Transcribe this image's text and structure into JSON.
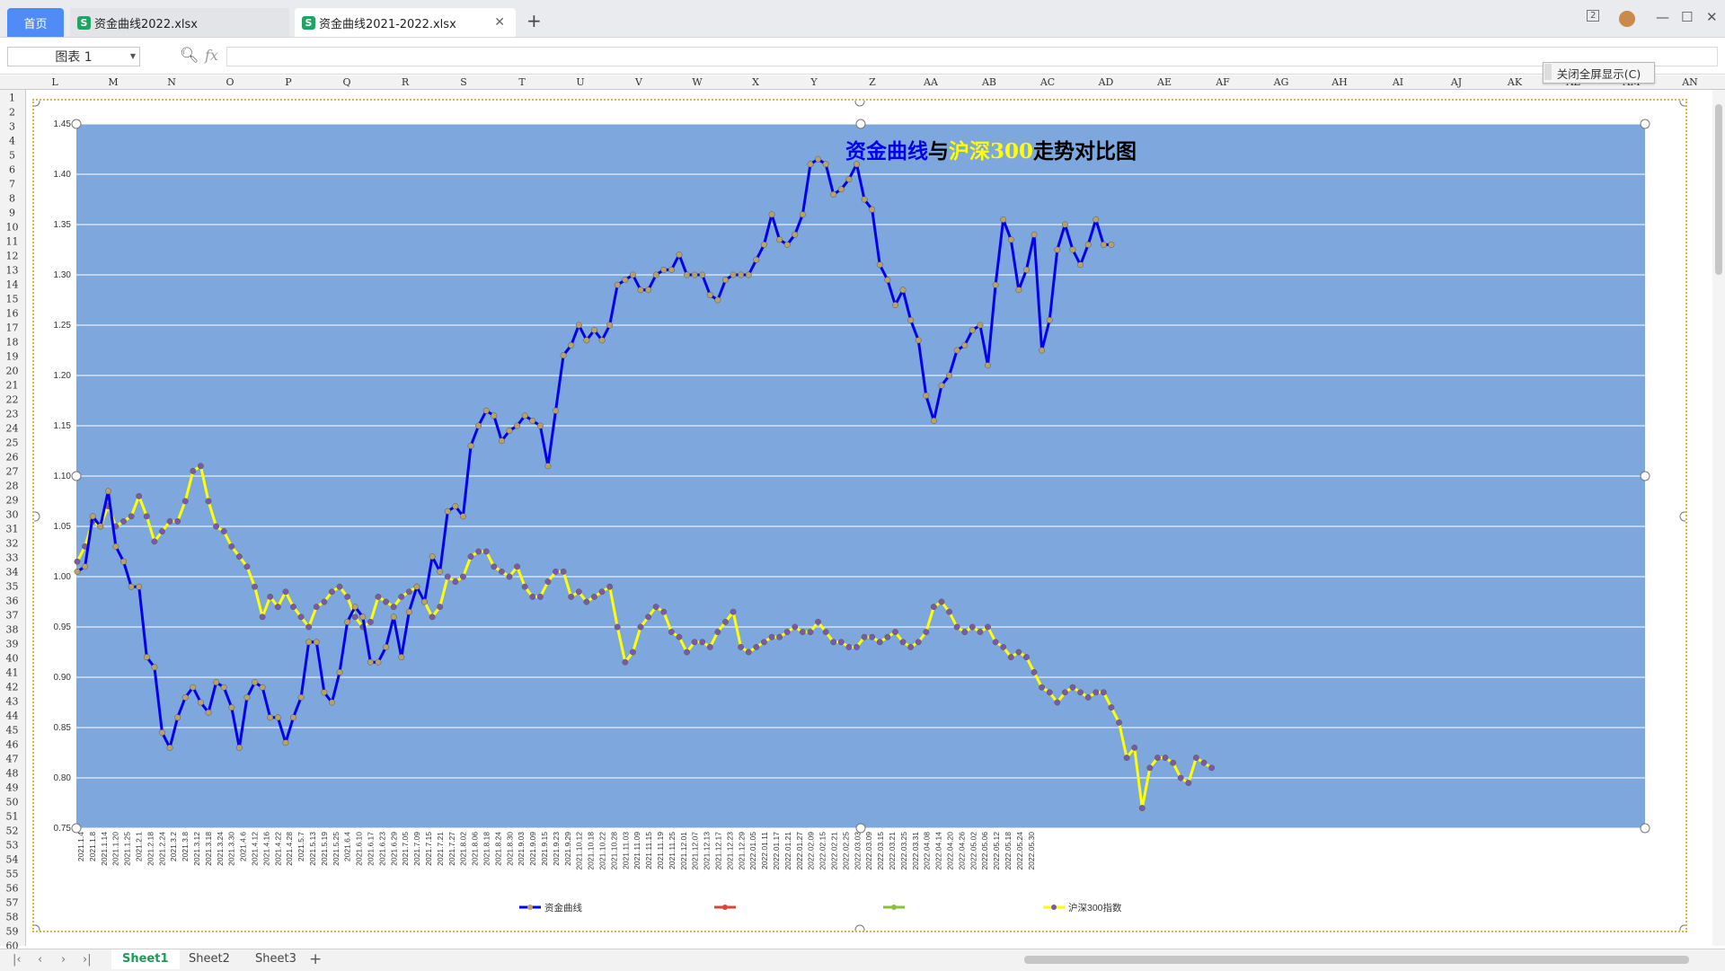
{
  "tabs": {
    "home": "首页",
    "file1": "资金曲线2022.xlsx",
    "file2": "资金曲线2021-2022.xlsx",
    "file_icon_letter": "S"
  },
  "window": {
    "layout_badge": "2",
    "avatar_text": "头像"
  },
  "toolbar": {
    "name_box": "图表 1",
    "fx": "fx",
    "formula_value": ""
  },
  "exit_fullscreen": "关闭全屏显示(C)",
  "columns": [
    "L",
    "M",
    "N",
    "O",
    "P",
    "Q",
    "R",
    "S",
    "T",
    "U",
    "V",
    "W",
    "X",
    "Y",
    "Z",
    "AA",
    "AB",
    "AC",
    "AD",
    "AE",
    "AF",
    "AG",
    "AH",
    "AI",
    "AJ",
    "AK",
    "AL",
    "AM",
    "AN"
  ],
  "rows": [
    1,
    2,
    3,
    4,
    5,
    6,
    7,
    8,
    9,
    10,
    11,
    12,
    13,
    14,
    15,
    16,
    17,
    18,
    19,
    20,
    21,
    22,
    23,
    24,
    25,
    26,
    27,
    28,
    29,
    30,
    31,
    32,
    33,
    34,
    35,
    36,
    37,
    38,
    39,
    40,
    41,
    42,
    43,
    44,
    45,
    46,
    47,
    48,
    49,
    50,
    51,
    52,
    53,
    54,
    55,
    56,
    57,
    58,
    59,
    60
  ],
  "sheets": [
    "Sheet1",
    "Sheet2",
    "Sheet3"
  ],
  "colors": {
    "plot_bg": "#7da7dd",
    "capital_line": "#0000ee",
    "hs300_line": "#ffff00",
    "capital_marker": "#b8a26a",
    "hs300_marker": "#7a5aa6",
    "series2": "#d9443b",
    "series3": "#8bbf3e",
    "selection": "#d8b443"
  },
  "chart_data": {
    "type": "line",
    "title_parts": [
      {
        "text": "资金曲线",
        "color": "#0000ee"
      },
      {
        "text": "与",
        "color": "#000000"
      },
      {
        "text": "沪深300",
        "color": "#ffff00"
      },
      {
        "text": "走势对比图",
        "color": "#000000"
      }
    ],
    "ylim": [
      0.75,
      1.45
    ],
    "yticks": [
      "1.45",
      "1.40",
      "1.35",
      "1.30",
      "1.25",
      "1.20",
      "1.15",
      "1.10",
      "1.05",
      "1.00",
      "0.95",
      "0.90",
      "0.85",
      "0.80",
      "0.75"
    ],
    "x_date_labels": [
      "2021.1.4",
      "2021.1.8",
      "2021.1.14",
      "2021.1.20",
      "2021.1.25",
      "2021.2.1",
      "2021.2.18",
      "2021.2.24",
      "2021.3.2",
      "2021.3.8",
      "2021.3.12",
      "2021.3.18",
      "2021.3.24",
      "2021.3.30",
      "2021.4.6",
      "2021.4.12",
      "2021.4.16",
      "2021.4.22",
      "2021.4.28",
      "2021.5.7",
      "2021.5.13",
      "2021.5.19",
      "2021.5.25",
      "2021.6.4",
      "2021.6.10",
      "2021.6.17",
      "2021.6.23",
      "2021.6.29",
      "2021.7.05",
      "2021.7.09",
      "2021.7.15",
      "2021.7.21",
      "2021.7.27",
      "2021.8.02",
      "2021.8.06",
      "2021.8.18",
      "2021.8.24",
      "2021.8.30",
      "2021.9.03",
      "2021.9.09",
      "2021.9.15",
      "2021.9.23",
      "2021.9.29",
      "2021.10.12",
      "2021.10.18",
      "2021.10.22",
      "2021.10.28",
      "2021.11.03",
      "2021.11.09",
      "2021.11.15",
      "2021.11.19",
      "2021.11.25",
      "2021.12.01",
      "2021.12.07",
      "2021.12.13",
      "2021.12.17",
      "2021.12.23",
      "2021.12.29",
      "2022.01.05",
      "2022.01.11",
      "2022.01.17",
      "2022.01.21",
      "2022.01.27",
      "2022.02.09",
      "2022.02.15",
      "2022.02.21",
      "2022.02.25",
      "2022.03.03",
      "2022.03.09",
      "2022.03.15",
      "2022.03.21",
      "2022.03.25",
      "2022.03.31",
      "2022.04.08",
      "2022.04.14",
      "2022.04.20",
      "2022.04.26",
      "2022.05.02",
      "2022.05.06",
      "2022.05.12",
      "2022.05.18",
      "2022.05.24",
      "2022.05.30"
    ],
    "series": [
      {
        "name": "资金曲线",
        "color": "#0000ee",
        "values": [
          1.005,
          1.01,
          1.06,
          1.05,
          1.085,
          1.03,
          1.015,
          0.99,
          0.99,
          0.92,
          0.91,
          0.845,
          0.83,
          0.86,
          0.88,
          0.89,
          0.875,
          0.865,
          0.895,
          0.89,
          0.87,
          0.83,
          0.88,
          0.895,
          0.89,
          0.86,
          0.86,
          0.835,
          0.86,
          0.88,
          0.935,
          0.935,
          0.885,
          0.875,
          0.905,
          0.955,
          0.97,
          0.96,
          0.915,
          0.915,
          0.93,
          0.96,
          0.92,
          0.965,
          0.99,
          0.975,
          1.02,
          1.005,
          1.065,
          1.07,
          1.06,
          1.13,
          1.15,
          1.165,
          1.16,
          1.135,
          1.145,
          1.15,
          1.16,
          1.155,
          1.15,
          1.11,
          1.165,
          1.22,
          1.23,
          1.25,
          1.235,
          1.245,
          1.235,
          1.25,
          1.29,
          1.295,
          1.3,
          1.285,
          1.285,
          1.3,
          1.305,
          1.305,
          1.32,
          1.3,
          1.3,
          1.3,
          1.28,
          1.275,
          1.295,
          1.3,
          1.3,
          1.3,
          1.315,
          1.33,
          1.36,
          1.335,
          1.33,
          1.34,
          1.36,
          1.41,
          1.415,
          1.41,
          1.38,
          1.385,
          1.395,
          1.41,
          1.375,
          1.365,
          1.31,
          1.295,
          1.27,
          1.285,
          1.255,
          1.235,
          1.18,
          1.155,
          1.19,
          1.2,
          1.225,
          1.23,
          1.245,
          1.25,
          1.21,
          1.29,
          1.355,
          1.335,
          1.285,
          1.305,
          1.34,
          1.225,
          1.255,
          1.325,
          1.35,
          1.325,
          1.31,
          1.33,
          1.355,
          1.33,
          1.33
        ]
      },
      {
        "name": "",
        "color": "#d9443b",
        "values": []
      },
      {
        "name": "",
        "color": "#8bbf3e",
        "values": []
      },
      {
        "name": "沪深300指数",
        "color": "#ffff00",
        "values": [
          1.015,
          1.03,
          1.055,
          1.05,
          1.07,
          1.05,
          1.055,
          1.06,
          1.08,
          1.06,
          1.035,
          1.045,
          1.055,
          1.055,
          1.075,
          1.105,
          1.11,
          1.075,
          1.05,
          1.045,
          1.03,
          1.02,
          1.01,
          0.99,
          0.96,
          0.98,
          0.97,
          0.985,
          0.97,
          0.96,
          0.95,
          0.97,
          0.975,
          0.985,
          0.99,
          0.98,
          0.96,
          0.95,
          0.955,
          0.98,
          0.975,
          0.97,
          0.98,
          0.985,
          0.99,
          0.975,
          0.96,
          0.97,
          1.0,
          0.995,
          1.0,
          1.02,
          1.025,
          1.025,
          1.01,
          1.005,
          1.0,
          1.01,
          0.99,
          0.98,
          0.98,
          0.995,
          1.005,
          1.005,
          0.98,
          0.985,
          0.975,
          0.98,
          0.985,
          0.99,
          0.95,
          0.915,
          0.925,
          0.95,
          0.96,
          0.97,
          0.965,
          0.945,
          0.94,
          0.925,
          0.935,
          0.935,
          0.93,
          0.945,
          0.955,
          0.965,
          0.93,
          0.925,
          0.93,
          0.935,
          0.94,
          0.94,
          0.945,
          0.95,
          0.945,
          0.945,
          0.955,
          0.945,
          0.935,
          0.935,
          0.93,
          0.93,
          0.94,
          0.94,
          0.935,
          0.94,
          0.945,
          0.935,
          0.93,
          0.935,
          0.945,
          0.97,
          0.975,
          0.965,
          0.95,
          0.945,
          0.95,
          0.945,
          0.95,
          0.935,
          0.93,
          0.92,
          0.925,
          0.92,
          0.905,
          0.89,
          0.885,
          0.875,
          0.885,
          0.89,
          0.885,
          0.88,
          0.885,
          0.885,
          0.87,
          0.855,
          0.82,
          0.83,
          0.77,
          0.81,
          0.82,
          0.82,
          0.815,
          0.8,
          0.795,
          0.82,
          0.815,
          0.81
        ]
      }
    ],
    "grid": "horizontal",
    "legend_position": "bottom"
  }
}
